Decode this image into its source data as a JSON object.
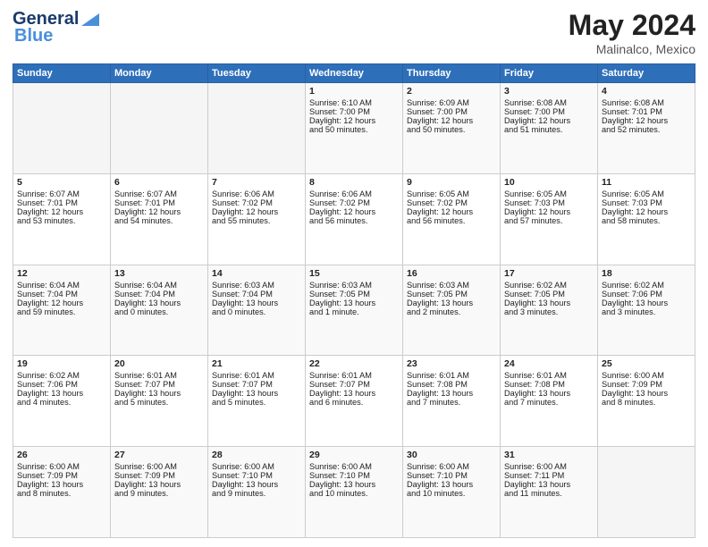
{
  "header": {
    "logo_general": "General",
    "logo_blue": "Blue",
    "title": "May 2024",
    "location": "Malinalco, Mexico"
  },
  "days_of_week": [
    "Sunday",
    "Monday",
    "Tuesday",
    "Wednesday",
    "Thursday",
    "Friday",
    "Saturday"
  ],
  "weeks": [
    [
      {
        "day": "",
        "info": ""
      },
      {
        "day": "",
        "info": ""
      },
      {
        "day": "",
        "info": ""
      },
      {
        "day": "1",
        "info": "Sunrise: 6:10 AM\nSunset: 7:00 PM\nDaylight: 12 hours\nand 50 minutes."
      },
      {
        "day": "2",
        "info": "Sunrise: 6:09 AM\nSunset: 7:00 PM\nDaylight: 12 hours\nand 50 minutes."
      },
      {
        "day": "3",
        "info": "Sunrise: 6:08 AM\nSunset: 7:00 PM\nDaylight: 12 hours\nand 51 minutes."
      },
      {
        "day": "4",
        "info": "Sunrise: 6:08 AM\nSunset: 7:01 PM\nDaylight: 12 hours\nand 52 minutes."
      }
    ],
    [
      {
        "day": "5",
        "info": "Sunrise: 6:07 AM\nSunset: 7:01 PM\nDaylight: 12 hours\nand 53 minutes."
      },
      {
        "day": "6",
        "info": "Sunrise: 6:07 AM\nSunset: 7:01 PM\nDaylight: 12 hours\nand 54 minutes."
      },
      {
        "day": "7",
        "info": "Sunrise: 6:06 AM\nSunset: 7:02 PM\nDaylight: 12 hours\nand 55 minutes."
      },
      {
        "day": "8",
        "info": "Sunrise: 6:06 AM\nSunset: 7:02 PM\nDaylight: 12 hours\nand 56 minutes."
      },
      {
        "day": "9",
        "info": "Sunrise: 6:05 AM\nSunset: 7:02 PM\nDaylight: 12 hours\nand 56 minutes."
      },
      {
        "day": "10",
        "info": "Sunrise: 6:05 AM\nSunset: 7:03 PM\nDaylight: 12 hours\nand 57 minutes."
      },
      {
        "day": "11",
        "info": "Sunrise: 6:05 AM\nSunset: 7:03 PM\nDaylight: 12 hours\nand 58 minutes."
      }
    ],
    [
      {
        "day": "12",
        "info": "Sunrise: 6:04 AM\nSunset: 7:04 PM\nDaylight: 12 hours\nand 59 minutes."
      },
      {
        "day": "13",
        "info": "Sunrise: 6:04 AM\nSunset: 7:04 PM\nDaylight: 13 hours\nand 0 minutes."
      },
      {
        "day": "14",
        "info": "Sunrise: 6:03 AM\nSunset: 7:04 PM\nDaylight: 13 hours\nand 0 minutes."
      },
      {
        "day": "15",
        "info": "Sunrise: 6:03 AM\nSunset: 7:05 PM\nDaylight: 13 hours\nand 1 minute."
      },
      {
        "day": "16",
        "info": "Sunrise: 6:03 AM\nSunset: 7:05 PM\nDaylight: 13 hours\nand 2 minutes."
      },
      {
        "day": "17",
        "info": "Sunrise: 6:02 AM\nSunset: 7:05 PM\nDaylight: 13 hours\nand 3 minutes."
      },
      {
        "day": "18",
        "info": "Sunrise: 6:02 AM\nSunset: 7:06 PM\nDaylight: 13 hours\nand 3 minutes."
      }
    ],
    [
      {
        "day": "19",
        "info": "Sunrise: 6:02 AM\nSunset: 7:06 PM\nDaylight: 13 hours\nand 4 minutes."
      },
      {
        "day": "20",
        "info": "Sunrise: 6:01 AM\nSunset: 7:07 PM\nDaylight: 13 hours\nand 5 minutes."
      },
      {
        "day": "21",
        "info": "Sunrise: 6:01 AM\nSunset: 7:07 PM\nDaylight: 13 hours\nand 5 minutes."
      },
      {
        "day": "22",
        "info": "Sunrise: 6:01 AM\nSunset: 7:07 PM\nDaylight: 13 hours\nand 6 minutes."
      },
      {
        "day": "23",
        "info": "Sunrise: 6:01 AM\nSunset: 7:08 PM\nDaylight: 13 hours\nand 7 minutes."
      },
      {
        "day": "24",
        "info": "Sunrise: 6:01 AM\nSunset: 7:08 PM\nDaylight: 13 hours\nand 7 minutes."
      },
      {
        "day": "25",
        "info": "Sunrise: 6:00 AM\nSunset: 7:09 PM\nDaylight: 13 hours\nand 8 minutes."
      }
    ],
    [
      {
        "day": "26",
        "info": "Sunrise: 6:00 AM\nSunset: 7:09 PM\nDaylight: 13 hours\nand 8 minutes."
      },
      {
        "day": "27",
        "info": "Sunrise: 6:00 AM\nSunset: 7:09 PM\nDaylight: 13 hours\nand 9 minutes."
      },
      {
        "day": "28",
        "info": "Sunrise: 6:00 AM\nSunset: 7:10 PM\nDaylight: 13 hours\nand 9 minutes."
      },
      {
        "day": "29",
        "info": "Sunrise: 6:00 AM\nSunset: 7:10 PM\nDaylight: 13 hours\nand 10 minutes."
      },
      {
        "day": "30",
        "info": "Sunrise: 6:00 AM\nSunset: 7:10 PM\nDaylight: 13 hours\nand 10 minutes."
      },
      {
        "day": "31",
        "info": "Sunrise: 6:00 AM\nSunset: 7:11 PM\nDaylight: 13 hours\nand 11 minutes."
      },
      {
        "day": "",
        "info": ""
      }
    ]
  ]
}
